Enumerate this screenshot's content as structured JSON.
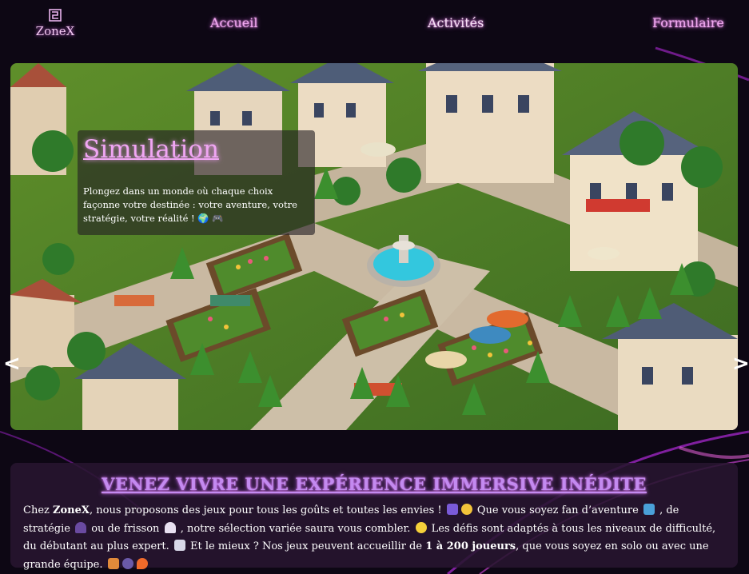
{
  "header": {
    "logo_text": "ZoneX",
    "nav": [
      {
        "label": "Accueil"
      },
      {
        "label": "Activités"
      },
      {
        "label": "Formulaire"
      }
    ]
  },
  "carousel": {
    "slide_title": "Simulation",
    "slide_description": "Plongez dans un monde où chaque choix façonne votre destinée : votre aventure, votre stratégie, votre réalité ! 🌍 🎮",
    "prev_label": "<",
    "next_label": ">"
  },
  "info": {
    "title": "Venez vivre une expérience immersive inédite",
    "p1": "Chez ",
    "brand": "ZoneX",
    "p2": ", nous proposons des jeux pour tous les goûts et toutes les envies ! ",
    "p3": " Que vous soyez fan d’aventure ",
    "p4": " , de stratégie ",
    "p5": " ou de frisson ",
    "p6": " , notre sélection variée saura vous combler. ",
    "p7": " Les défis sont adaptés à tous les niveaux de difficulté, du débutant au plus expert. ",
    "p8": " Et le mieux ? Nos jeux peuvent accueillir de ",
    "players": "1 à 200 joueurs",
    "p9": ", que vous soyez en solo ou avec une grande équipe. "
  },
  "colors": {
    "background": "#0d0714",
    "accent_pink": "#f0a6f3",
    "accent_purple": "#c38af0",
    "panel": "#281630"
  }
}
